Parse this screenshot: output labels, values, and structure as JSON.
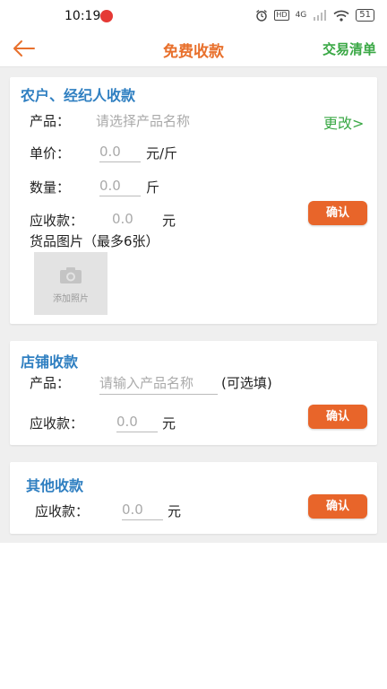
{
  "status_bar": {
    "time": "10:19",
    "hd": "HD",
    "net": "4G",
    "battery": "51"
  },
  "header": {
    "title": "免费收款",
    "right_link": "交易清单"
  },
  "farmer_card": {
    "title": "农户、经纪人收款",
    "product_label": "产品：",
    "product_placeholder": "请选择产品名称",
    "change_link": "更改>",
    "price_label": "单价：",
    "price_value": "0.0",
    "price_unit": "元/斤",
    "qty_label": "数量：",
    "qty_value": "0.0",
    "qty_unit": "斤",
    "receivable_label": "应收款：",
    "receivable_value": "0.0",
    "receivable_unit": "元",
    "confirm_label": "确认",
    "photos_label": "货品图片（最多6张）",
    "add_photo_label": "添加照片"
  },
  "shop_card": {
    "title": "店铺收款",
    "product_label": "产品：",
    "product_placeholder": "请输入产品名称",
    "optional_note": "(可选填)",
    "receivable_label": "应收款：",
    "receivable_value": "0.0",
    "receivable_unit": "元",
    "confirm_label": "确认"
  },
  "other_card": {
    "title": "其他收款",
    "receivable_label": "应收款：",
    "receivable_value": "0.0",
    "receivable_unit": "元",
    "confirm_label": "确认"
  },
  "colors": {
    "accent_orange": "#e8702c",
    "button_orange": "#e8652a",
    "title_blue": "#2f7fc1",
    "link_green": "#3aa845",
    "background_gray": "#efefef"
  }
}
